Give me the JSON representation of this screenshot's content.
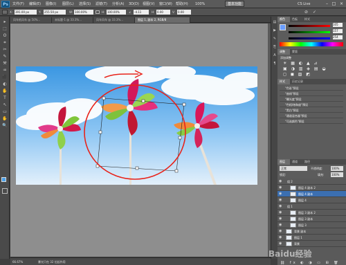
{
  "menubar": {
    "logo": "Ps",
    "items": [
      "文件(F)",
      "编辑(E)",
      "图像(I)",
      "图层(L)",
      "选择(S)",
      "滤镜(T)",
      "分析(A)",
      "3D(D)",
      "视图(V)",
      "窗口(W)",
      "帮助(H)"
    ],
    "zoom_display": "100%",
    "workspace_button": "基本功能",
    "cs_live": "CS Live",
    "win_buttons": [
      "–",
      "□",
      "×"
    ]
  },
  "options": {
    "x_label": "X:",
    "x_value": "391.00 px",
    "y_label": "Y:",
    "y_value": "255.50 px",
    "w_label": "W:",
    "w_value": "100.00%",
    "h_label": "H:",
    "h_value": "100.00%",
    "angle_value": "-4.11",
    "hskew_label": "H:",
    "hskew_value": "0.00",
    "vskew_label": "V:",
    "vskew_value": "0.00"
  },
  "tabs": [
    {
      "label": "风车纸风车 @ 50%..."
    },
    {
      "label": "未标题-1 @ 33.3%..."
    },
    {
      "label": "风车风车 @ 33.3%..."
    },
    {
      "label": "图层 1, 副本 2, RGB/8"
    }
  ],
  "tools": [
    "▸",
    "⬚",
    "ʘ",
    "⌗",
    "✂",
    "✎",
    "⚒",
    "♒",
    "⬛",
    "◐",
    "✋",
    "T",
    "↖",
    "▭",
    "✋",
    "🔍"
  ],
  "status": {
    "zoom": "66.67%",
    "info": "暴光只在 32 位起作用"
  },
  "panels": {
    "color_tabs": [
      "颜色",
      "色板",
      "样式"
    ],
    "color_values": {
      "r": "105",
      "g": "157",
      "b": "254"
    },
    "adjust_tabs": [
      "调整",
      "蒙版"
    ],
    "adjust_title": "添加调整",
    "styles_tabs": [
      "样式",
      "历史记录"
    ],
    "actions": [
      "\"色彩\"预设",
      "\"曲线\"预设",
      "\"曝光度\"预设",
      "\"色相/饱和度\"预设",
      "\"黑白\"预设",
      "\"通道混合器\"预设",
      "\"可选颜色\"预设"
    ],
    "layers_tabs": [
      "图层",
      "通道",
      "路径"
    ],
    "blend_mode": "正常",
    "opacity_label": "不透明度:",
    "opacity_value": "100%",
    "lock_label": "锁定:",
    "fill_label": "填充:",
    "fill_value": "100%",
    "layers": [
      {
        "name": "组 2",
        "type": "group",
        "selected": false
      },
      {
        "name": "图层 4 副本 2",
        "type": "layer",
        "selected": false
      },
      {
        "name": "图层 4 副本",
        "type": "layer",
        "selected": true
      },
      {
        "name": "图层 4",
        "type": "layer",
        "selected": false
      },
      {
        "name": "组 1",
        "type": "group",
        "selected": false
      },
      {
        "name": "图层 3 副本 2",
        "type": "layer",
        "selected": false
      },
      {
        "name": "图层 3 副本",
        "type": "layer",
        "selected": false
      },
      {
        "name": "图层 3",
        "type": "layer",
        "selected": false
      },
      {
        "name": "背景 副本",
        "type": "layer",
        "selected": false
      },
      {
        "name": "图层 1",
        "type": "layer",
        "selected": false
      },
      {
        "name": "背景",
        "type": "layer",
        "selected": false
      }
    ]
  },
  "watermark": "Baidu经验",
  "colors": {
    "accent_selection": "#3b6fb1",
    "annotation_red": "#e8231a",
    "sky_top": "#4a9fe3",
    "sky_bottom": "#d9ecfb"
  }
}
